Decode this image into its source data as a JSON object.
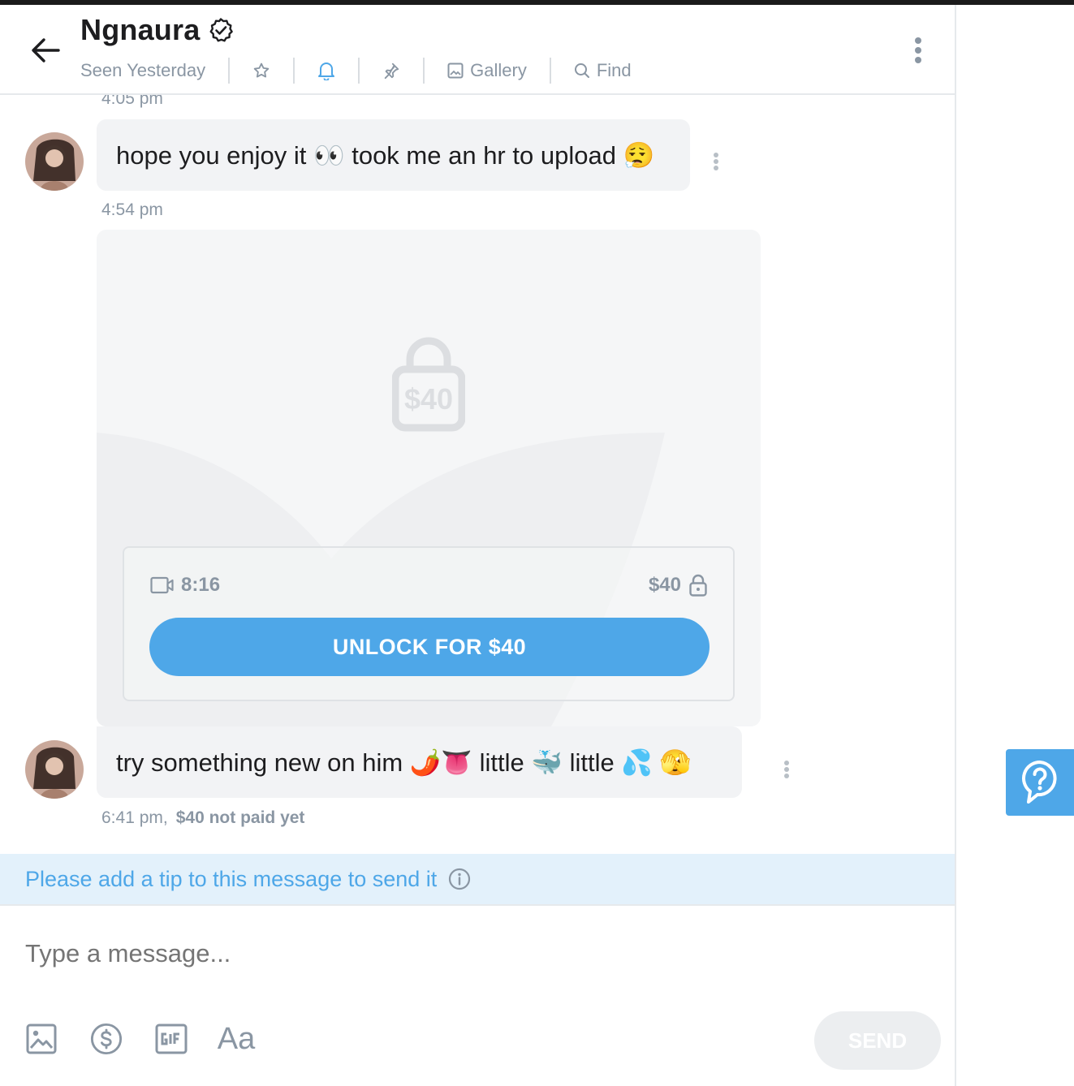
{
  "header": {
    "name": "Ngnaura",
    "seen": "Seen Yesterday",
    "gallery_label": "Gallery",
    "find_label": "Find"
  },
  "messages": [
    {
      "timestamp": "4:05 pm"
    },
    {
      "text": "hope you enjoy it 👀 took me an hr to upload 😮‍💨",
      "timestamp_after": "4:54 pm"
    },
    {
      "media": {
        "lock_price": "$40",
        "duration": "8:16",
        "price": "$40",
        "unlock_label": "UNLOCK FOR $40"
      }
    },
    {
      "text": "try something new on him 🌶️👅 little 🐳 little 💦 🫣",
      "timestamp": "6:41 pm,",
      "payment_status": "$40 not paid yet"
    }
  ],
  "tip_banner": {
    "text": "Please add a tip to this message to send it"
  },
  "composer": {
    "placeholder": "Type a message...",
    "font_label": "Aa",
    "send_label": "SEND"
  },
  "colors": {
    "accent": "#4ea7e8",
    "muted": "#8a96a3",
    "bubble": "#f2f3f5",
    "banner": "#e3f1fb"
  },
  "icons": [
    "back-arrow-icon",
    "verified-badge-icon",
    "star-icon",
    "bell-icon",
    "pin-icon",
    "gallery-icon",
    "search-icon",
    "more-vertical-icon",
    "video-icon",
    "lock-icon",
    "info-icon",
    "image-icon",
    "dollar-icon",
    "gif-icon",
    "help-icon"
  ]
}
